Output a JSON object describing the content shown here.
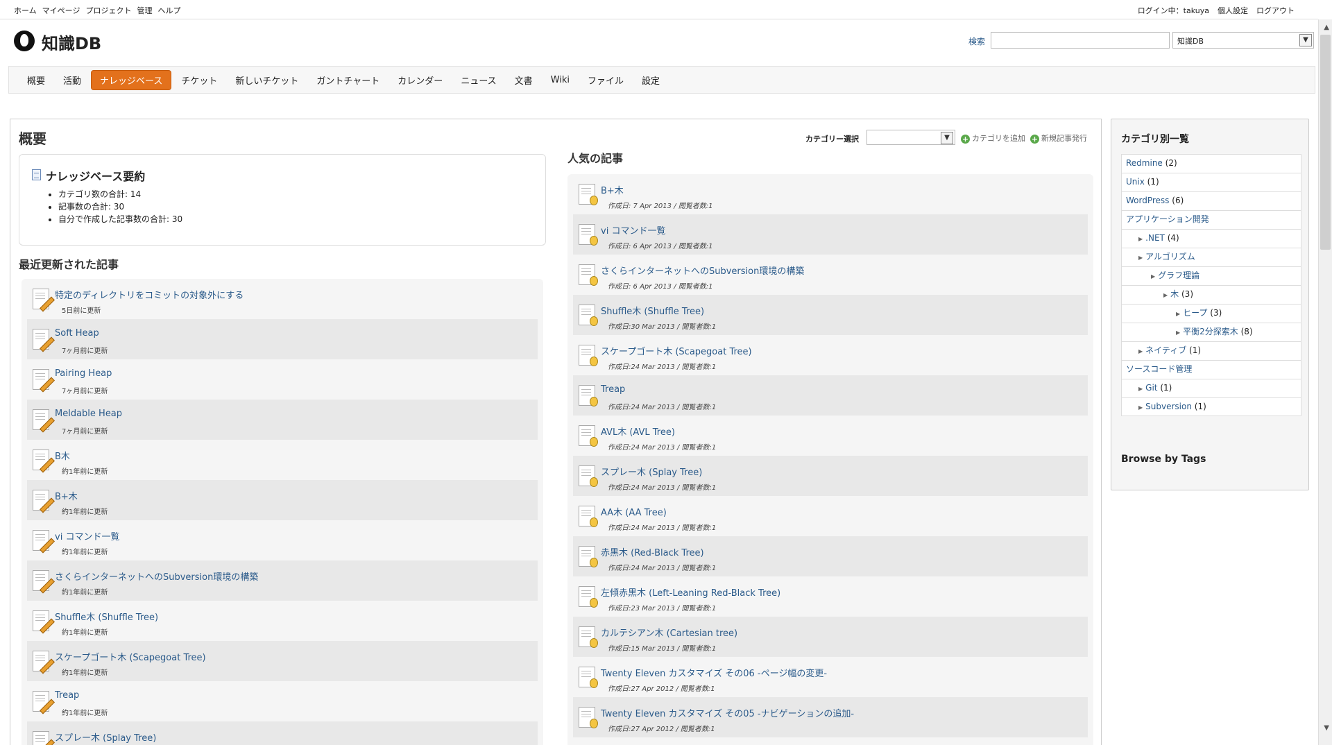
{
  "top_menu": {
    "left": [
      "ホーム",
      "マイページ",
      "プロジェクト",
      "管理",
      "ヘルプ"
    ],
    "logged_in": "ログイン中：takuya",
    "settings": "個人設定",
    "logout": "ログアウト"
  },
  "header": {
    "title": "知識DB",
    "search_label": "検索",
    "project_select": "知識DB"
  },
  "main_menu": [
    "概要",
    "活動",
    "ナレッジベース",
    "チケット",
    "新しいチケット",
    "ガントチャート",
    "カレンダー",
    "ニュース",
    "文書",
    "Wiki",
    "ファイル",
    "設定"
  ],
  "content": {
    "title": "概要",
    "summary": {
      "title": "ナレッジベース要約",
      "items": [
        "カテゴリ数の合計: 14",
        "記事数の合計: 30",
        "自分で作成した記事数の合計: 30"
      ]
    },
    "recent_title": "最近更新された記事",
    "recent": [
      {
        "title": "特定のディレクトリをコミットの対象外にする",
        "meta": "5日前に更新"
      },
      {
        "title": "Soft Heap",
        "meta": "7ヶ月前に更新"
      },
      {
        "title": "Pairing Heap",
        "meta": "7ヶ月前に更新"
      },
      {
        "title": "Meldable Heap",
        "meta": "7ヶ月前に更新"
      },
      {
        "title": "B木",
        "meta": "約1年前に更新"
      },
      {
        "title": "B+木",
        "meta": "約1年前に更新"
      },
      {
        "title": "vi コマンド一覧",
        "meta": "約1年前に更新"
      },
      {
        "title": "さくらインターネットへのSubversion環境の構築",
        "meta": "約1年前に更新"
      },
      {
        "title": "Shuffle木 (Shuffle Tree)",
        "meta": "約1年前に更新"
      },
      {
        "title": "スケープゴート木 (Scapegoat Tree)",
        "meta": "約1年前に更新"
      },
      {
        "title": "Treap",
        "meta": "約1年前に更新"
      },
      {
        "title": "スプレー木 (Splay Tree)",
        "meta": ""
      }
    ],
    "category_select_label": "カテゴリー選択",
    "add_category": "カテゴリを追加",
    "new_article": "新規記事発行",
    "popular_title": "人気の記事",
    "popular": [
      {
        "title": "B+木",
        "meta": "作成日: 7 Apr 2013 / 閲覧者数:1"
      },
      {
        "title": "vi コマンド一覧",
        "meta": "作成日: 6 Apr 2013 / 閲覧者数:1"
      },
      {
        "title": "さくらインターネットへのSubversion環境の構築",
        "meta": "作成日: 6 Apr 2013 / 閲覧者数:1"
      },
      {
        "title": "Shuffle木 (Shuffle Tree)",
        "meta": "作成日:30 Mar 2013 / 閲覧者数:1"
      },
      {
        "title": "スケープゴート木 (Scapegoat Tree)",
        "meta": "作成日:24 Mar 2013 / 閲覧者数:1"
      },
      {
        "title": "Treap",
        "meta": "作成日:24 Mar 2013 / 閲覧者数:1"
      },
      {
        "title": "AVL木 (AVL Tree)",
        "meta": "作成日:24 Mar 2013 / 閲覧者数:1"
      },
      {
        "title": "スプレー木 (Splay Tree)",
        "meta": "作成日:24 Mar 2013 / 閲覧者数:1"
      },
      {
        "title": "AA木 (AA Tree)",
        "meta": "作成日:24 Mar 2013 / 閲覧者数:1"
      },
      {
        "title": "赤黒木 (Red-Black Tree)",
        "meta": "作成日:24 Mar 2013 / 閲覧者数:1"
      },
      {
        "title": "左傾赤黒木 (Left-Leaning Red-Black Tree)",
        "meta": "作成日:23 Mar 2013 / 閲覧者数:1"
      },
      {
        "title": "カルテシアン木 (Cartesian tree)",
        "meta": "作成日:15 Mar 2013 / 閲覧者数:1"
      },
      {
        "title": "Twenty Eleven カスタマイズ その06 -ページ幅の変更-",
        "meta": "作成日:27 Apr 2012 / 閲覧者数:1"
      },
      {
        "title": "Twenty Eleven カスタマイズ その05 -ナビゲーションの追加-",
        "meta": "作成日:27 Apr 2012 / 閲覧者数:1"
      }
    ]
  },
  "sidebar": {
    "title": "カテゴリ別一覧",
    "categories": [
      {
        "name": "Redmine",
        "count": "(2)",
        "level": 0
      },
      {
        "name": "Unix",
        "count": "(1)",
        "level": 0
      },
      {
        "name": "WordPress",
        "count": "(6)",
        "level": 0
      },
      {
        "name": "アプリケーション開発",
        "count": "",
        "level": 0
      },
      {
        "name": ".NET",
        "count": "(4)",
        "level": 1
      },
      {
        "name": "アルゴリズム",
        "count": "",
        "level": 1
      },
      {
        "name": "グラフ理論",
        "count": "",
        "level": 2
      },
      {
        "name": "木",
        "count": "(3)",
        "level": 3
      },
      {
        "name": "ヒープ",
        "count": "(3)",
        "level": 4
      },
      {
        "name": "平衡2分探索木",
        "count": "(8)",
        "level": 4
      },
      {
        "name": "ネイティブ",
        "count": "(1)",
        "level": 1
      },
      {
        "name": "ソースコード管理",
        "count": "",
        "level": 0
      },
      {
        "name": "Git",
        "count": "(1)",
        "level": 1
      },
      {
        "name": "Subversion",
        "count": "(1)",
        "level": 1
      }
    ],
    "tags_title": "Browse by Tags"
  }
}
